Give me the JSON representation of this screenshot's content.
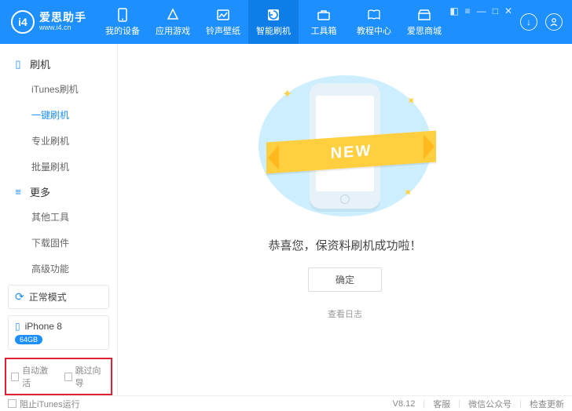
{
  "brand": {
    "initials": "i4",
    "title": "爱思助手",
    "url": "www.i4.cn"
  },
  "nav": [
    {
      "label": "我的设备"
    },
    {
      "label": "应用游戏"
    },
    {
      "label": "铃声壁纸"
    },
    {
      "label": "智能刷机"
    },
    {
      "label": "工具箱"
    },
    {
      "label": "教程中心"
    },
    {
      "label": "爱思商城"
    }
  ],
  "sidebar": {
    "groups": [
      {
        "title": "刷机",
        "items": [
          "iTunes刷机",
          "一键刷机",
          "专业刷机",
          "批量刷机"
        ],
        "activeIndex": 1
      },
      {
        "title": "更多",
        "items": [
          "其他工具",
          "下载固件",
          "高级功能"
        ]
      }
    ],
    "status": "正常模式",
    "device": {
      "name": "iPhone 8",
      "storage": "64GB"
    },
    "checkboxes": {
      "auto_activate": "自动激活",
      "skip_guide": "跳过向导"
    }
  },
  "main": {
    "ribbon": "NEW",
    "message": "恭喜您，保资料刷机成功啦！",
    "ok": "确定",
    "view_log": "查看日志"
  },
  "footer": {
    "block_itunes": "阻止iTunes运行",
    "version": "V8.12",
    "support": "客服",
    "wechat": "微信公众号",
    "update": "检查更新"
  }
}
